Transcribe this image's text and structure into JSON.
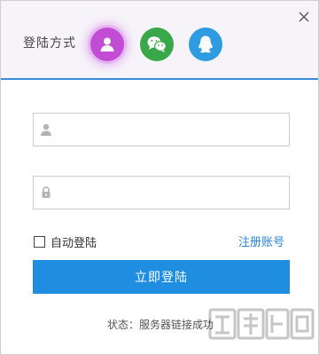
{
  "header": {
    "login_method_label": "登陆方式",
    "methods": [
      {
        "id": "account",
        "icon": "user-icon",
        "color": "#c34cd4"
      },
      {
        "id": "wechat",
        "icon": "wechat-icon",
        "color": "#39a84a"
      },
      {
        "id": "qq",
        "icon": "qq-penguin-icon",
        "color": "#2f9be0"
      }
    ],
    "accent_color": "#3a8bdb"
  },
  "form": {
    "username": {
      "value": "",
      "placeholder": "",
      "icon": "user-icon"
    },
    "password": {
      "value": "",
      "placeholder": "",
      "icon": "lock-icon"
    },
    "auto_login_label": "自动登陆",
    "auto_login_checked": false,
    "register_label": "注册账号",
    "login_button_label": "立即登陆",
    "login_button_color": "#1f8ee0"
  },
  "status": {
    "label": "状态：",
    "value": "服务器链接成功"
  },
  "watermark": {
    "icon": "site-logo-icon"
  }
}
